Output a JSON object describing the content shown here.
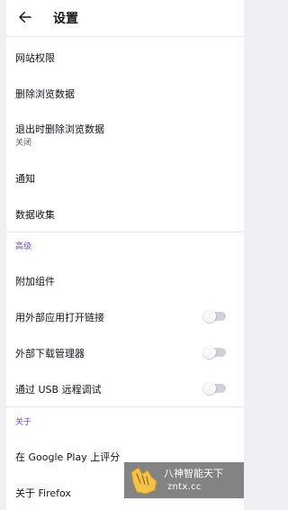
{
  "header": {
    "title": "设置"
  },
  "items": {
    "site_permissions": "网站权限",
    "delete_browsing_data": "删除浏览数据",
    "delete_on_quit": {
      "label": "退出时删除浏览数据",
      "value": "关闭"
    },
    "notifications": "通知",
    "data_collection": "数据收集"
  },
  "sections": {
    "advanced": "高级",
    "about": "关于"
  },
  "advanced_items": {
    "addons": "附加组件",
    "open_links_external": {
      "label": "用外部应用打开链接",
      "enabled": false
    },
    "external_download_manager": {
      "label": "外部下载管理器",
      "enabled": false
    },
    "usb_remote_debugging": {
      "label": "通过 USB 远程调试",
      "enabled": false
    }
  },
  "about_items": {
    "rate_google_play": "在 Google Play 上评分",
    "about_firefox": "关于 Firefox"
  },
  "watermark": {
    "line1": "八神智能天下",
    "line2": "zntx.cc"
  },
  "colors": {
    "accent": "#7542e5",
    "toggle_track": "#cfcfd8",
    "toggle_knob": "#f9f9fb"
  }
}
